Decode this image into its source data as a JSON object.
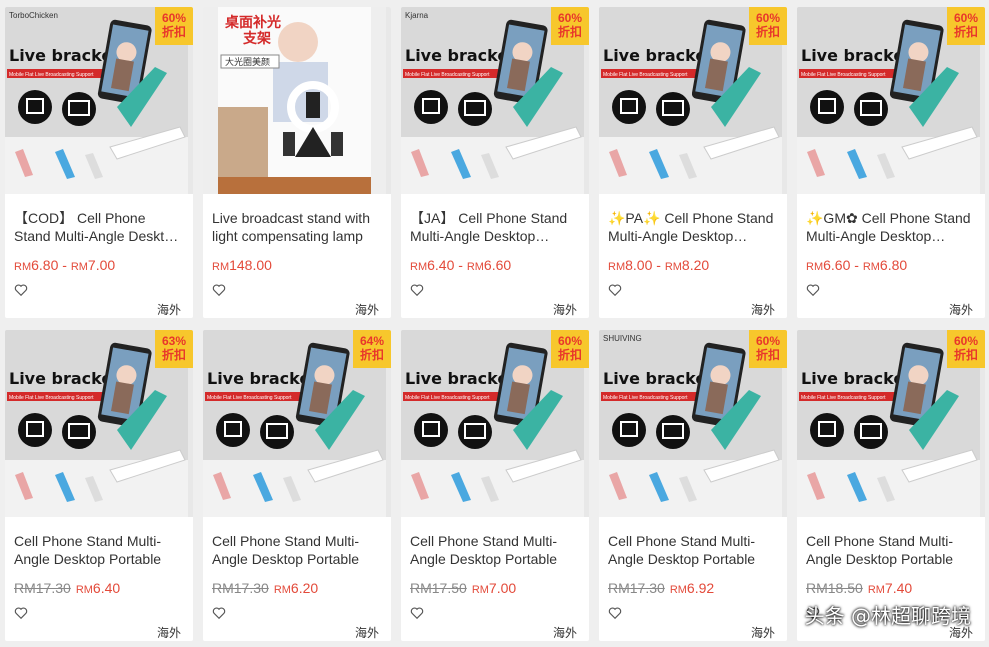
{
  "products": [
    {
      "brand": "TorboChicken",
      "badge_pct": "60%",
      "badge_txt": "折扣",
      "title": "【COD】 Cell Phone Stand Multi-Angle Desktop Portable",
      "price_old": "",
      "price_from": "RM6.80",
      "price_to": "RM7.00",
      "origin": "海外",
      "variant": "stand"
    },
    {
      "brand": "",
      "badge_pct": "",
      "badge_txt": "",
      "title": "Live broadcast stand with light compensating lamp",
      "price_old": "",
      "price_from": "RM148.00",
      "price_to": "",
      "origin": "海外",
      "variant": "ring",
      "ring_text": "桌面补光支架",
      "ring_sub": "大光圈美颜"
    },
    {
      "brand": "Kjarna",
      "badge_pct": "60%",
      "badge_txt": "折扣",
      "title": "【JA】 Cell Phone Stand Multi-Angle Desktop Portable",
      "price_old": "",
      "price_from": "RM6.40",
      "price_to": "RM6.60",
      "origin": "海外",
      "variant": "stand"
    },
    {
      "brand": "",
      "badge_pct": "60%",
      "badge_txt": "折扣",
      "title": "✨PA✨ Cell Phone Stand Multi-Angle Desktop Portable",
      "price_old": "",
      "price_from": "RM8.00",
      "price_to": "RM8.20",
      "origin": "海外",
      "variant": "stand"
    },
    {
      "brand": "",
      "badge_pct": "60%",
      "badge_txt": "折扣",
      "title": "✨GM✿ Cell Phone Stand Multi-Angle Desktop Portable",
      "price_old": "",
      "price_from": "RM6.60",
      "price_to": "RM6.80",
      "origin": "海外",
      "variant": "stand"
    },
    {
      "brand": "",
      "badge_pct": "63%",
      "badge_txt": "折扣",
      "title": "Cell Phone Stand Multi-Angle Desktop Portable",
      "price_old": "RM17.30",
      "price_from": "RM6.40",
      "price_to": "",
      "origin": "海外",
      "variant": "stand"
    },
    {
      "brand": "",
      "badge_pct": "64%",
      "badge_txt": "折扣",
      "title": "Cell Phone Stand Multi-Angle Desktop Portable",
      "price_old": "RM17.30",
      "price_from": "RM6.20",
      "price_to": "",
      "origin": "海外",
      "variant": "stand"
    },
    {
      "brand": "",
      "badge_pct": "60%",
      "badge_txt": "折扣",
      "title": "Cell Phone Stand Multi-Angle Desktop Portable",
      "price_old": "RM17.50",
      "price_from": "RM7.00",
      "price_to": "",
      "origin": "海外",
      "variant": "stand"
    },
    {
      "brand": "SHUIVING",
      "badge_pct": "60%",
      "badge_txt": "折扣",
      "title": "Cell Phone Stand Multi-Angle Desktop Portable",
      "price_old": "RM17.30",
      "price_from": "RM6.92",
      "price_to": "",
      "origin": "海外",
      "variant": "stand"
    },
    {
      "brand": "",
      "badge_pct": "60%",
      "badge_txt": "折扣",
      "title": "Cell Phone Stand Multi-Angle Desktop Portable",
      "price_old": "RM18.50",
      "price_from": "RM7.40",
      "price_to": "",
      "origin": "海外",
      "variant": "stand"
    }
  ],
  "image_text": {
    "headline": "Live bracket",
    "subline": "Mobile Flat Live Broadcasting Support"
  },
  "watermark": "头条 @林超聊跨境",
  "colors": {
    "price": "#e34a3a",
    "badge_bg": "#f7c72c",
    "badge_fg": "#e8372b",
    "teal": "#3bb3a3"
  }
}
